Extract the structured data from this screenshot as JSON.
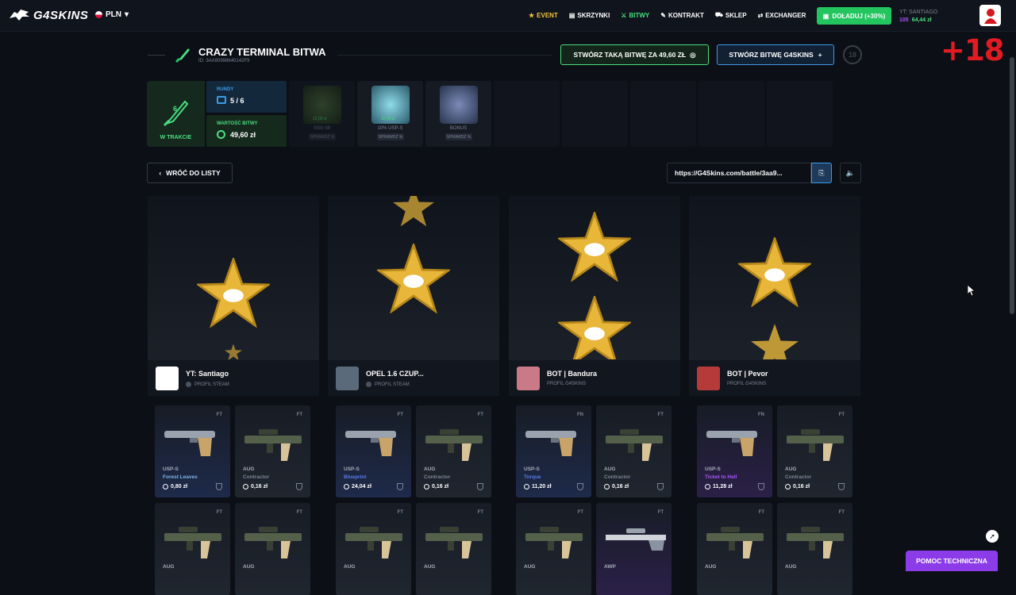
{
  "topbar": {
    "logo": "G4SKINS",
    "currency": "PLN",
    "nav": [
      {
        "label": "EVENT",
        "icon": "star-icon"
      },
      {
        "label": "SKRZYNKI",
        "icon": "grid-icon"
      },
      {
        "label": "BITWY",
        "icon": "battle-icon"
      },
      {
        "label": "KONTRAKT",
        "icon": "pen-icon"
      },
      {
        "label": "SKLEP",
        "icon": "cart-icon"
      },
      {
        "label": "EXCHANGER",
        "icon": "exchange-icon"
      }
    ],
    "deposit_label": "DOŁADUJ (+30%)",
    "user": {
      "name": "YT: SANTIAGO",
      "points": "105",
      "balance": "64,44 zł"
    }
  },
  "age_badge": "+18",
  "battle": {
    "title": "CRAZY TERMINAL BITWA",
    "id": "ID: 3AA90998640142F9",
    "create_same": "STWÓRZ TAKĄ BITWĘ ZA 49,60 ZŁ",
    "create_g4": "STWÓRZ BITWĘ G4SKINS",
    "players_badge": "18",
    "status_number": "6",
    "status_label": "W TRAKCIE",
    "rounds_label": "RUNDY",
    "rounds_value": "5 / 6",
    "value_label": "WARTOŚĆ BITWY",
    "value_value": "49,60 zł",
    "cases": [
      {
        "name": "SSG 08",
        "price": "12,00 zł",
        "check": "SPRAWDŹ %"
      },
      {
        "name": "10% USP-S",
        "price": "10,00 zł",
        "check": "SPRAWDŹ %"
      },
      {
        "name": "BONUS",
        "price": "",
        "check": "SPRAWDŹ %"
      }
    ]
  },
  "controls": {
    "back": "WRÓĆ DO LISTY",
    "url": "https://G4Skins.com/battle/3aa9..."
  },
  "players": [
    {
      "name": "YT: Santiago",
      "source": "PROFIL STEAM"
    },
    {
      "name": "OPEL 1.6 CZUP...",
      "source": "PROFIL STEAM"
    },
    {
      "name": "BOT | Bandura",
      "source": "PROFIL G4SKINS"
    },
    {
      "name": "BOT | Pevor",
      "source": "PROFIL G4SKINS"
    }
  ],
  "items_row1": [
    {
      "wear": "FT",
      "type": "USP-S",
      "skin": "Forest Leaves",
      "price": "0,80 zł",
      "skin_color": "#7fb3e8"
    },
    {
      "wear": "FT",
      "type": "AUG",
      "skin": "Contractor",
      "price": "0,16 zł",
      "skin_color": "#7b8494"
    },
    {
      "wear": "FT",
      "type": "USP-S",
      "skin": "Blueprint",
      "price": "24,04 zł",
      "skin_color": "#5b7ae8"
    },
    {
      "wear": "FT",
      "type": "AUG",
      "skin": "Contractor",
      "price": "0,16 zł",
      "skin_color": "#7b8494"
    },
    {
      "wear": "FN",
      "type": "USP-S",
      "skin": "Torque",
      "price": "11,20 zł",
      "skin_color": "#5b7ae8"
    },
    {
      "wear": "FT",
      "type": "AUG",
      "skin": "Contractor",
      "price": "0,16 zł",
      "skin_color": "#7b8494"
    },
    {
      "wear": "FN",
      "type": "USP-S",
      "skin": "Ticket to Hell",
      "price": "11,28 zł",
      "skin_color": "#a855f7"
    },
    {
      "wear": "FT",
      "type": "AUG",
      "skin": "Contractor",
      "price": "0,16 zł",
      "skin_color": "#7b8494"
    }
  ],
  "items_row2": [
    {
      "wear": "FT",
      "type": "AUG"
    },
    {
      "wear": "FT",
      "type": "AUG"
    },
    {
      "wear": "FT",
      "type": "AUG"
    },
    {
      "wear": "FT",
      "type": "AUG"
    },
    {
      "wear": "FT",
      "type": "AUG"
    },
    {
      "wear": "FT",
      "type": "AWP"
    },
    {
      "wear": "FT",
      "type": "AUG"
    },
    {
      "wear": "FT",
      "type": "AUG"
    }
  ],
  "help": "POMOC TECHNICZNA"
}
